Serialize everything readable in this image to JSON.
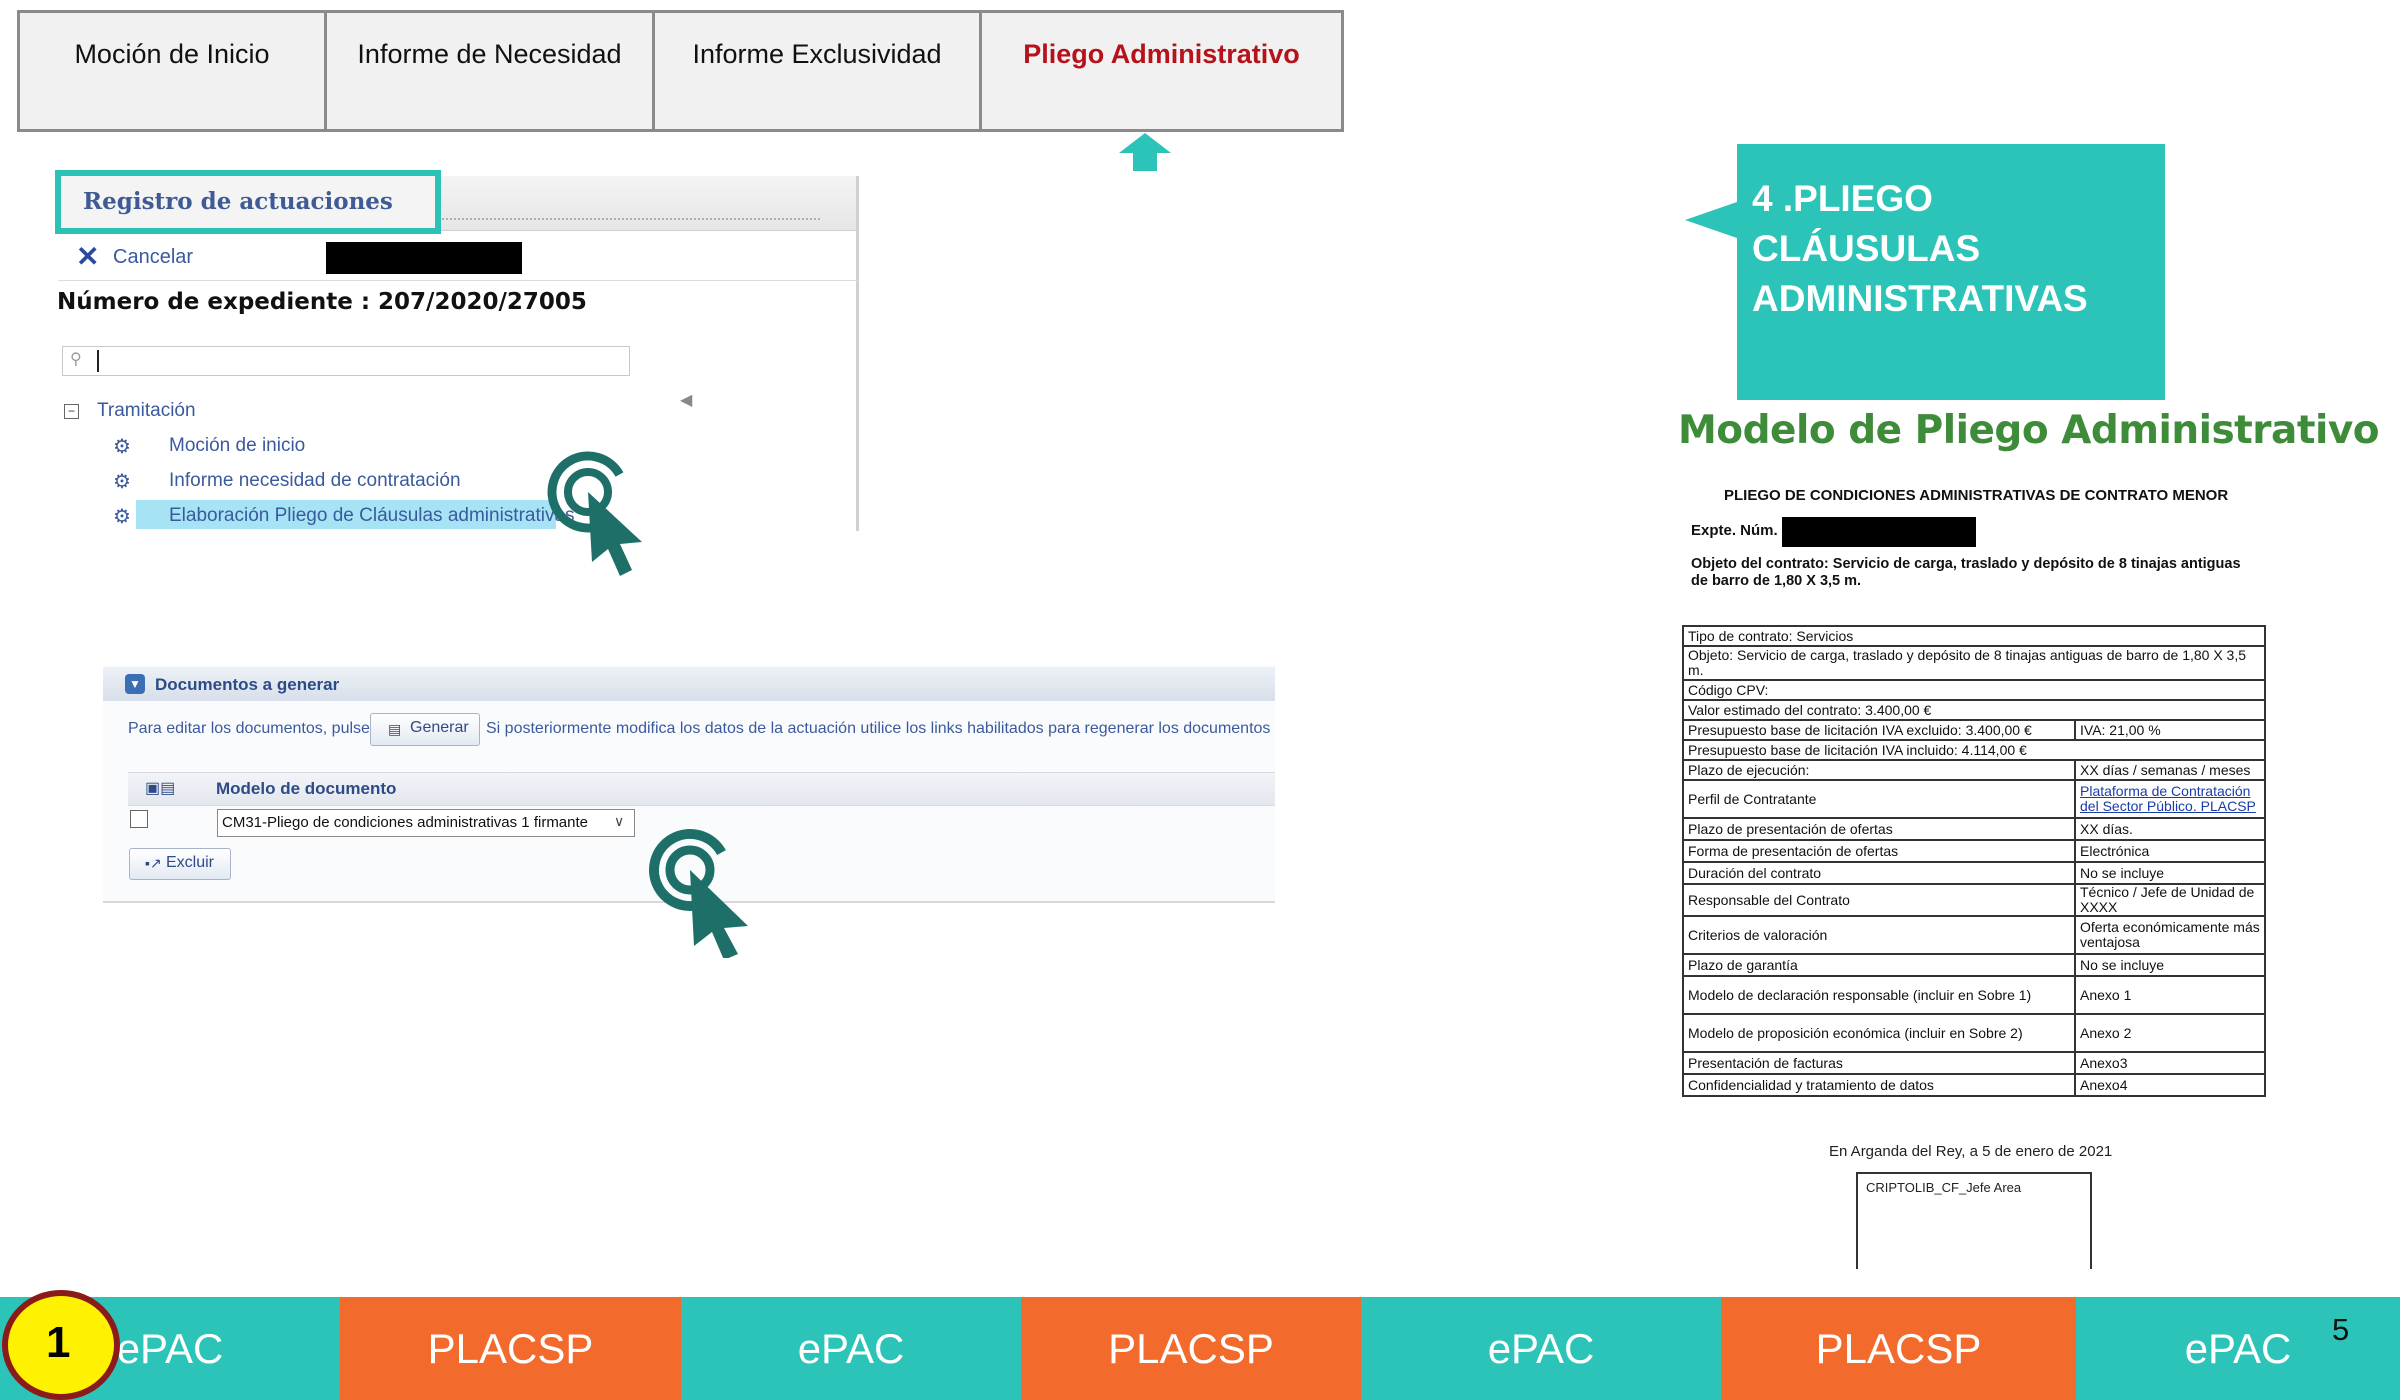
{
  "top_tabs": [
    {
      "label": "Moción de Inicio"
    },
    {
      "label": "Informe de Necesidad"
    },
    {
      "label": "Informe Exclusividad"
    },
    {
      "label": "Pliego Administrativo"
    }
  ],
  "registro": {
    "title": "Registro de actuaciones",
    "cancel_label": "Cancelar",
    "expediente": "Número de expediente : 207/2020/27005",
    "tree_root": "Tramitación",
    "tree_items": [
      "Moción de inicio",
      "Informe necesidad de contratación",
      "Elaboración Pliego de Cláusulas administrativas"
    ]
  },
  "documentos": {
    "title": "Documentos a generar",
    "instruction_before": "Para editar los documentos, pulse",
    "generate_label": "Generar",
    "instruction_after": "Si posteriormente modifica los datos de la actuación utilice los links habilitados para regenerar los documentos",
    "column_header": "Modelo de documento",
    "selected_model": "CM31-Pliego de condiciones administrativas 1 firmante",
    "exclude_label": "Excluir"
  },
  "callout": {
    "line1": "4 .PLIEGO",
    "line2": "CLÁUSULAS",
    "line3": "ADMINISTRATIVAS"
  },
  "modelo": {
    "heading": "Modelo de Pliego Administrativo",
    "doc_title": "PLIEGO DE CONDICIONES ADMINISTRATIVAS DE CONTRATO MENOR",
    "expte_label": "Expte. Núm.",
    "objeto": "Objeto del contrato: Servicio de carga, traslado y depósito de 8 tinajas antiguas de barro de 1,80 X 3,5 m.",
    "tipo": "Tipo de contrato: Servicios",
    "objeto_row": "Objeto: Servicio de carga, traslado y depósito de 8 tinajas antiguas de barro de 1,80 X 3,5 m.",
    "cpv": "Código CPV:",
    "valor": "Valor estimado del contrato: 3.400,00 €",
    "presupuesto_excl": "Presupuesto base de licitación IVA excluido: 3.400,00 €",
    "iva": "IVA: 21,00 %",
    "presupuesto_incl": "Presupuesto base de licitación IVA incluido: 4.114,00 €",
    "rows": [
      {
        "label": "Plazo de ejecución:",
        "value": "XX días / semanas / meses"
      },
      {
        "label": "Perfil de Contratante",
        "value": "Plataforma de Contratación del Sector Público. PLACSP"
      },
      {
        "label": "Plazo de presentación de ofertas",
        "value": "XX días."
      },
      {
        "label": "Forma de presentación de ofertas",
        "value": "Electrónica"
      },
      {
        "label": "Duración del contrato",
        "value": "No se incluye"
      },
      {
        "label": "Responsable del Contrato",
        "value": "Técnico / Jefe de Unidad de XXXX"
      },
      {
        "label": "Criterios de valoración",
        "value": "Oferta económicamente más ventajosa"
      },
      {
        "label": "Plazo de garantía",
        "value": "No se incluye"
      },
      {
        "label": "Modelo de declaración responsable (incluir en Sobre 1)",
        "value": "Anexo 1"
      },
      {
        "label": "Modelo de proposición económica (incluir en Sobre 2)",
        "value": "Anexo 2"
      },
      {
        "label": "Presentación de facturas",
        "value": "Anexo3"
      },
      {
        "label": "Confidencialidad y tratamiento de datos",
        "value": "Anexo4"
      }
    ],
    "fecha": "En Arganda del Rey, a 5 de enero de 2021",
    "firma": "CRIPTOLIB_CF_Jefe Area"
  },
  "bottom_bar": [
    {
      "label": "ePAC",
      "color": "#2cc3b8"
    },
    {
      "label": "PLACSP",
      "color": "#f26a2c"
    },
    {
      "label": "ePAC",
      "color": "#2cc3b8"
    },
    {
      "label": "PLACSP",
      "color": "#f26a2c"
    },
    {
      "label": "ePAC",
      "color": "#2cc3b8"
    },
    {
      "label": "PLACSP",
      "color": "#f26a2c"
    },
    {
      "label": "ePAC",
      "color": "#2cc3b8"
    }
  ],
  "step_badge": "1",
  "page_number": "5",
  "colors": {
    "teal": "#2cc3b8",
    "orange": "#f26a2c",
    "dark_teal_icon": "#1d6f68",
    "green_heading": "#3e8b3a",
    "active_tab": "#b5121b"
  }
}
